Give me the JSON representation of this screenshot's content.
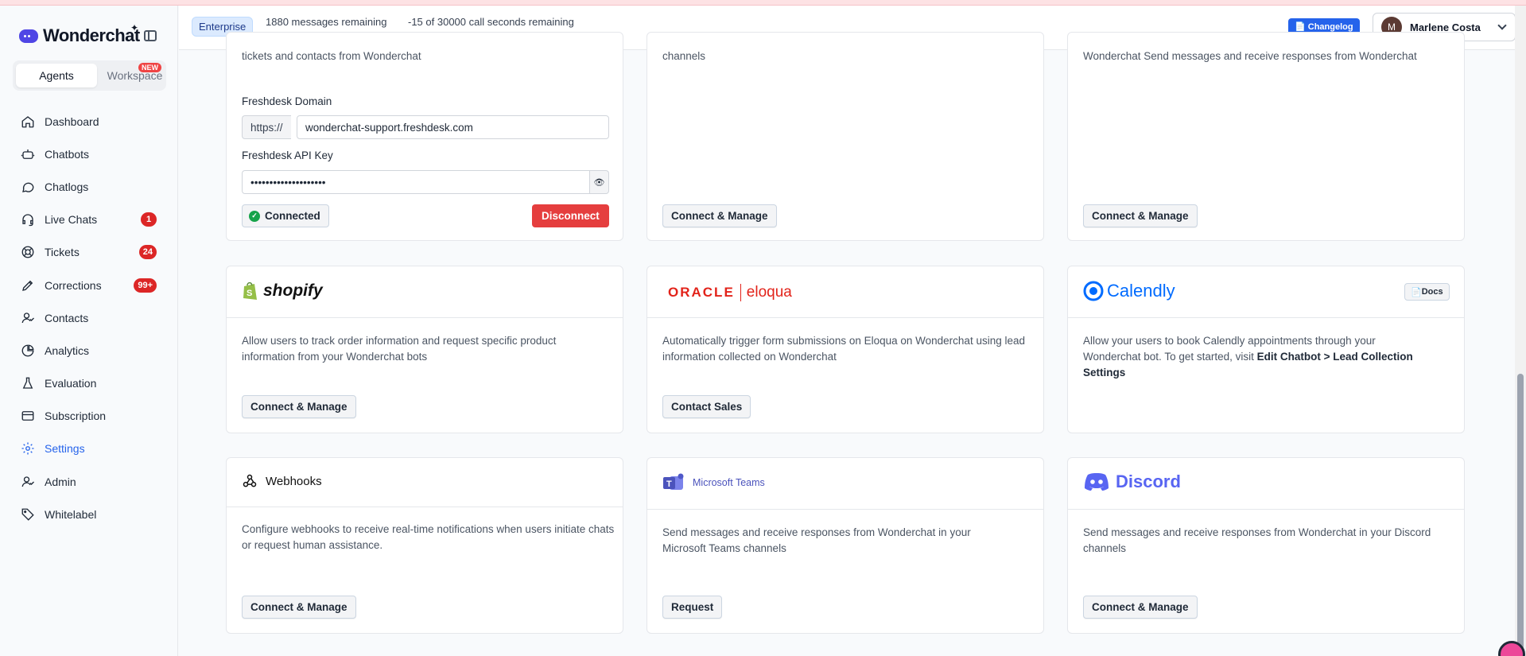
{
  "brand": {
    "name": "Wonderchat"
  },
  "sidebar": {
    "tabs": {
      "agents": "Agents",
      "workspace": "Workspace",
      "workspace_badge": "NEW"
    },
    "items": [
      {
        "label": "Dashboard",
        "icon": "home-icon"
      },
      {
        "label": "Chatbots",
        "icon": "bot-icon"
      },
      {
        "label": "Chatlogs",
        "icon": "chat-icon"
      },
      {
        "label": "Live Chats",
        "icon": "headset-icon",
        "count": "1"
      },
      {
        "label": "Tickets",
        "icon": "lifebuoy-icon",
        "count": "24"
      },
      {
        "label": "Corrections",
        "icon": "pencil-icon",
        "count": "99+"
      },
      {
        "label": "Contacts",
        "icon": "user-icon"
      },
      {
        "label": "Analytics",
        "icon": "pie-icon"
      },
      {
        "label": "Evaluation",
        "icon": "flask-icon"
      },
      {
        "label": "Subscription",
        "icon": "card-icon"
      },
      {
        "label": "Settings",
        "icon": "gear-icon",
        "active": true
      },
      {
        "label": "Admin",
        "icon": "user-icon"
      },
      {
        "label": "Whitelabel",
        "icon": "tag-icon"
      }
    ]
  },
  "header": {
    "plan": "Enterprise",
    "messages": {
      "label": "1880 messages remaining",
      "fill": 0.015
    },
    "calls": {
      "label": "-15 of 30000 call seconds remaining",
      "fill": 1.0
    },
    "changelog": "Changelog",
    "user": {
      "initial": "M",
      "name": "Marlene Costa"
    }
  },
  "cards": {
    "freshdesk": {
      "desc_tail": "tickets and contacts from Wonderchat",
      "domain_label": "Freshdesk Domain",
      "domain_prefix": "https://",
      "domain_value": "wonderchat-support.freshdesk.com",
      "api_label": "Freshdesk API Key",
      "api_value": "••••••••••••••••••••",
      "status": "Connected",
      "disconnect": "Disconnect"
    },
    "top_mid": {
      "desc_tail": "channels",
      "button": "Connect & Manage"
    },
    "top_right": {
      "desc_tail": "Wonderchat Send messages and receive responses from Wonderchat",
      "button": "Connect & Manage"
    },
    "shopify": {
      "logo": "shopify",
      "desc": "Allow users to track order information and request specific product information from your Wonderchat bots",
      "button": "Connect & Manage"
    },
    "eloqua": {
      "logo_a": "ORACLE",
      "logo_b": "eloqua",
      "desc": "Automatically trigger form submissions on Eloqua on Wonderchat using lead information collected on Wonderchat",
      "button": "Contact Sales"
    },
    "calendly": {
      "logo": "Calendly",
      "docs": "Docs",
      "desc": "Allow your users to book Calendly appointments through your Wonderchat bot. To get started, visit ",
      "desc_bold": "Edit Chatbot > Lead Collection Settings"
    },
    "webhooks": {
      "title": "Webhooks",
      "desc": "Configure webhooks to receive real-time notifications when users initiate chats or request human assistance.",
      "button": "Connect & Manage"
    },
    "teams": {
      "logo": "Microsoft Teams",
      "desc": "Send messages and receive responses from Wonderchat in your Microsoft Teams channels",
      "button": "Request"
    },
    "discord": {
      "logo": "Discord",
      "desc": "Send messages and receive responses from Wonderchat in your Discord channels",
      "button": "Connect & Manage"
    }
  },
  "colors": {
    "accent": "#2563eb",
    "danger": "#dc2626",
    "discord": "#5865f2",
    "oracle": "#e2231a",
    "calendly": "#006bff",
    "shopify": "#95bf47"
  }
}
